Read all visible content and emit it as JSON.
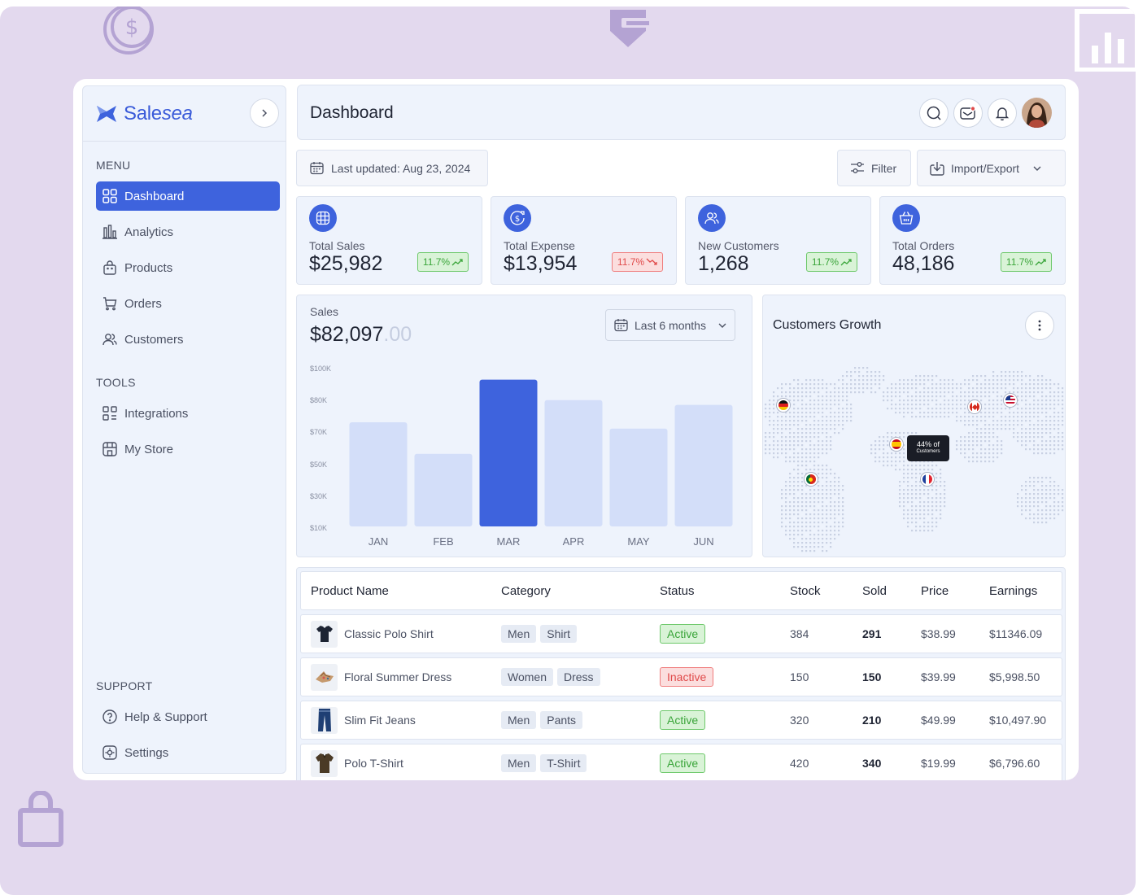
{
  "colors": {
    "accent": "#3e63dd",
    "bar_light": "#d3def9",
    "success": "#3aa53a",
    "danger": "#e04a4a",
    "backdrop": "#e3d9ee"
  },
  "brand": {
    "name_main": "Sale",
    "name_italic": "sea"
  },
  "sidebar": {
    "menu_label": "MENU",
    "menu_items": [
      {
        "label": "Dashboard",
        "icon": "grid-icon",
        "active": true
      },
      {
        "label": "Analytics",
        "icon": "bar-chart-icon"
      },
      {
        "label": "Products",
        "icon": "bag-icon"
      },
      {
        "label": "Orders",
        "icon": "cart-icon"
      },
      {
        "label": "Customers",
        "icon": "users-icon"
      }
    ],
    "tools_label": "TOOLS",
    "tools_items": [
      {
        "label": "Integrations",
        "icon": "integrations-icon"
      },
      {
        "label": "My Store",
        "icon": "store-icon"
      }
    ],
    "support_label": "SUPPORT",
    "support_items": [
      {
        "label": "Help & Support",
        "icon": "help-icon"
      },
      {
        "label": "Settings",
        "icon": "settings-icon"
      }
    ]
  },
  "header": {
    "title": "Dashboard"
  },
  "toolbar": {
    "last_updated": "Last updated: Aug 23, 2024",
    "filter_label": "Filter",
    "import_label": "Import/Export"
  },
  "stats": [
    {
      "label": "Total Sales",
      "value": "$25,982",
      "change": "11.7%",
      "trend": "up",
      "icon": "globe-icon"
    },
    {
      "label": "Total Expense",
      "value": "$13,954",
      "change": "11.7%",
      "trend": "down",
      "icon": "dollar-refresh-icon"
    },
    {
      "label": "New Customers",
      "value": "1,268",
      "change": "11.7%",
      "trend": "up",
      "icon": "users-icon"
    },
    {
      "label": "Total Orders",
      "value": "48,186",
      "change": "11.7%",
      "trend": "up",
      "icon": "basket-icon"
    }
  ],
  "sales": {
    "label": "Sales",
    "value_main": "$82,097",
    "value_cents": ".00",
    "period": "Last 6 months"
  },
  "chart_data": {
    "type": "bar",
    "categories": [
      "JAN",
      "FEB",
      "MAR",
      "APR",
      "MAY",
      "JUN"
    ],
    "values": [
      66,
      46,
      93,
      80,
      62,
      77
    ],
    "highlight": "MAR",
    "y_tick_labels": [
      "$100K",
      "$80K",
      "$70K",
      "$50K",
      "$30K",
      "$10K"
    ],
    "ylim": [
      0,
      100
    ],
    "grid": false
  },
  "customers_growth": {
    "title": "Customers Growth",
    "tooltip_value": "44% of",
    "tooltip_label": "Customers",
    "flags": [
      "germany-flag",
      "canada-flag",
      "usa-flag",
      "spain-flag",
      "france-flag",
      "portugal-flag"
    ]
  },
  "table": {
    "headers": [
      "Product Name",
      "Category",
      "Status",
      "Stock",
      "Sold",
      "Price",
      "Earnings"
    ],
    "rows": [
      {
        "name": "Classic Polo Shirt",
        "tags": [
          "Men",
          "Shirt"
        ],
        "status": "Active",
        "active": true,
        "stock": "384",
        "sold": "291",
        "price": "$38.99",
        "earnings": "$11346.09",
        "thumb": "polo-shirt-icon"
      },
      {
        "name": "Floral Summer Dress",
        "tags": [
          "Women",
          "Dress"
        ],
        "status": "Inactive",
        "active": false,
        "stock": "150",
        "sold": "150",
        "price": "$39.99",
        "earnings": "$5,998.50",
        "thumb": "dress-icon"
      },
      {
        "name": "Slim Fit Jeans",
        "tags": [
          "Men",
          "Pants"
        ],
        "status": "Active",
        "active": true,
        "stock": "320",
        "sold": "210",
        "price": "$49.99",
        "earnings": "$10,497.90",
        "thumb": "jeans-icon"
      },
      {
        "name": "Polo T-Shirt",
        "tags": [
          "Men",
          "T-Shirt"
        ],
        "status": "Active",
        "active": true,
        "stock": "420",
        "sold": "340",
        "price": "$19.99",
        "earnings": "$6,796.60",
        "thumb": "tshirt-icon"
      }
    ]
  }
}
